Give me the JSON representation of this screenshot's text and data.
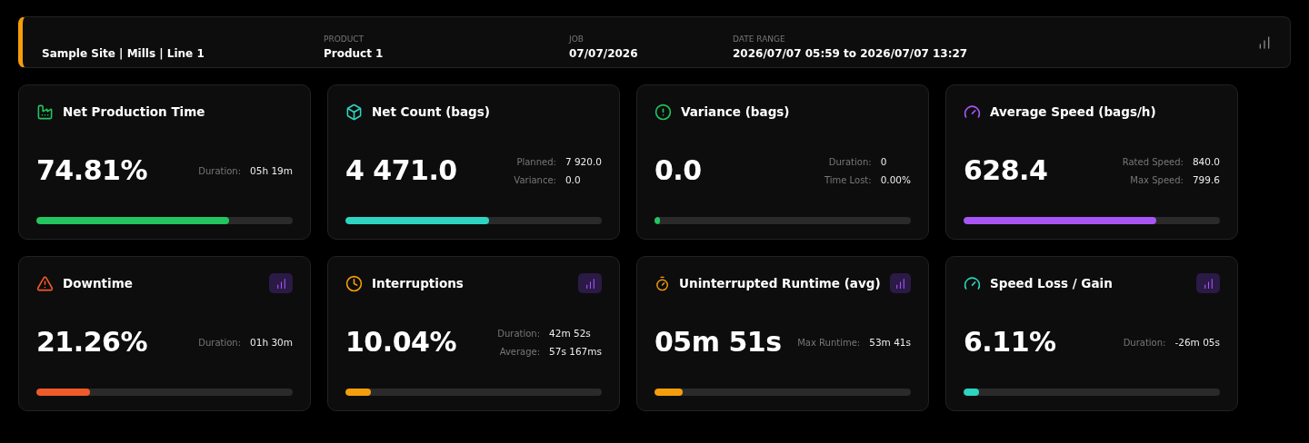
{
  "header": {
    "fields": [
      {
        "value": "Sample Site | Mills | Line 1"
      },
      {
        "label": "PRODUCT",
        "value": "Product 1"
      },
      {
        "label": "JOB",
        "value": "07/07/2026"
      },
      {
        "label": "DATE RANGE",
        "value": "2026/07/07 05:59 to 2026/07/07 13:27"
      }
    ]
  },
  "cards": [
    {
      "kind": "factory",
      "color": "#22c55e",
      "title": "Net Production Time",
      "value": "74.81%",
      "stats": [
        {
          "label": "Duration:",
          "value": "05h 19m"
        }
      ],
      "level": 0.75,
      "chart_button": false
    },
    {
      "kind": "box",
      "color": "#2dd4bf",
      "title": "Net Count (bags)",
      "value": "4 471.0",
      "stats": [
        {
          "label": "Planned:",
          "value": "7 920.0"
        },
        {
          "label": "Variance:",
          "value": "0.0"
        }
      ],
      "level": 0.56,
      "chart_button": false
    },
    {
      "kind": "alert",
      "color": "#22c55e",
      "title": "Variance (bags)",
      "value": "0.0",
      "stats": [
        {
          "label": "Duration:",
          "value": "0"
        },
        {
          "label": "Time Lost:",
          "value": "0.00%"
        }
      ],
      "level": 0.02,
      "chart_button": false
    },
    {
      "kind": "gauge",
      "color": "#a855f7",
      "title": "Average Speed (bags/h)",
      "value": "628.4",
      "stats": [
        {
          "label": "Rated Speed:",
          "value": "840.0"
        },
        {
          "label": "Max Speed:",
          "value": "799.6"
        }
      ],
      "level": 0.75,
      "chart_button": false
    },
    {
      "kind": "warning",
      "color": "#f05a28",
      "title": "Downtime",
      "value": "21.26%",
      "stats": [
        {
          "label": "Duration:",
          "value": "01h 30m"
        }
      ],
      "level": 0.21,
      "chart_button": true
    },
    {
      "kind": "clock",
      "color": "#f59e0b",
      "title": "Interruptions",
      "value": "10.04%",
      "stats": [
        {
          "label": "Duration:",
          "value": "42m 52s"
        },
        {
          "label": "Average:",
          "value": "57s 167ms"
        }
      ],
      "level": 0.1,
      "chart_button": true
    },
    {
      "kind": "timer",
      "color": "#f59e0b",
      "title": "Uninterrupted Runtime (avg)",
      "value": "05m 51s",
      "stats": [
        {
          "label": "Max Runtime:",
          "value": "53m 41s"
        }
      ],
      "level": 0.11,
      "chart_button": true
    },
    {
      "kind": "gauge",
      "color": "#2dd4bf",
      "title": "Speed Loss / Gain",
      "value": "6.11%",
      "stats": [
        {
          "label": "Duration:",
          "value": "-26m 05s"
        }
      ],
      "level": 0.06,
      "chart_button": true
    }
  ]
}
